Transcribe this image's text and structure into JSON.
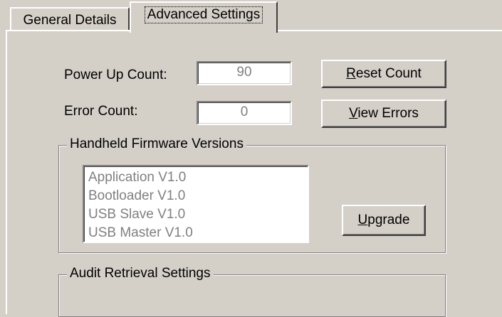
{
  "tabs": [
    {
      "label": "General Details",
      "active": false
    },
    {
      "label": "Advanced Settings",
      "active": true
    }
  ],
  "power_up": {
    "label": "Power Up Count:",
    "value": "90"
  },
  "error": {
    "label": "Error Count:",
    "value": "0"
  },
  "buttons": {
    "reset": {
      "mnemonic": "R",
      "rest": "eset Count"
    },
    "view_errors": {
      "mnemonic": "V",
      "rest": "iew Errors"
    },
    "upgrade": {
      "mnemonic": "U",
      "rest": "pgrade"
    }
  },
  "firmware": {
    "title": "Handheld Firmware Versions",
    "items": [
      "Application V1.0",
      "Bootloader V1.0",
      "USB Slave V1.0",
      "USB Master V1.0"
    ]
  },
  "audit": {
    "title": "Audit Retrieval Settings"
  },
  "colors": {
    "face": "#d4d0c8",
    "disabled_text": "#808080",
    "highlight": "#ffffff",
    "shadow": "#808080"
  }
}
